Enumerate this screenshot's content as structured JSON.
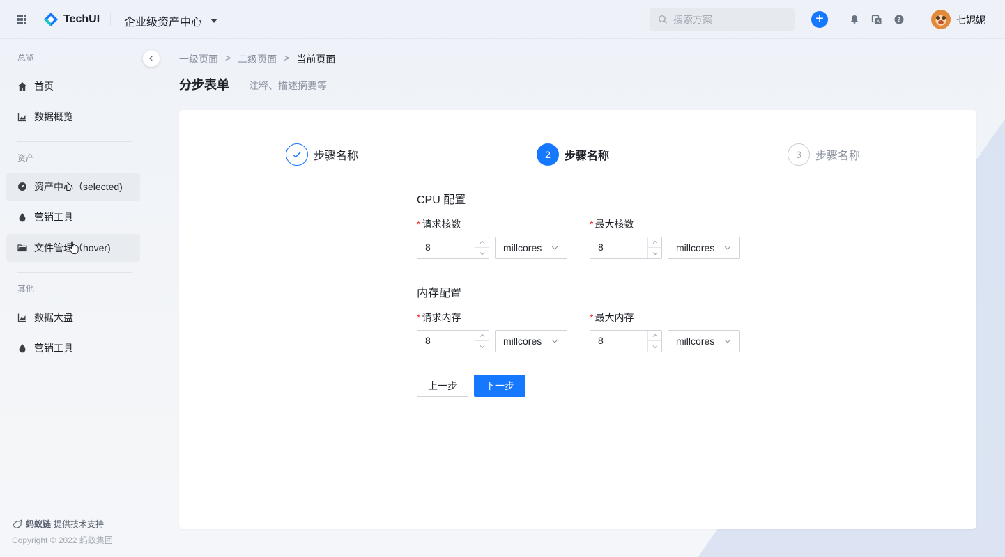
{
  "header": {
    "brand": "TechUI",
    "app_title": "企业级资产中心",
    "search_placeholder": "搜索方案",
    "plus_label": "+",
    "username": "七妮妮"
  },
  "sidebar": {
    "groups": [
      {
        "title": "总览"
      },
      {
        "title": "资产"
      },
      {
        "title": "其他"
      }
    ],
    "items": [
      {
        "label": "首页",
        "icon": "home-icon"
      },
      {
        "label": "数据概览",
        "icon": "chart-icon"
      },
      {
        "label": "资产中心（selected)",
        "icon": "dashboard-icon"
      },
      {
        "label": "营销工具",
        "icon": "drop-icon"
      },
      {
        "label": "文件管理（hover)",
        "icon": "folder-icon"
      },
      {
        "label": "数据大盘",
        "icon": "chart-icon"
      },
      {
        "label": "营销工具",
        "icon": "drop-icon"
      }
    ],
    "footer_brand": "蚂蚁链",
    "footer_support": "提供技术支持",
    "copyright": "Copyright © 2022 蚂蚁集团"
  },
  "breadcrumb": {
    "items": [
      "一级页面",
      "二级页面",
      "当前页面"
    ],
    "separator": ">"
  },
  "page": {
    "title": "分步表单",
    "subtitle": "注释、描述摘要等"
  },
  "steps": [
    {
      "label": "步骤名称",
      "status": "done",
      "index": ""
    },
    {
      "label": "步骤名称",
      "status": "active",
      "index": "2"
    },
    {
      "label": "步骤名称",
      "status": "wait",
      "index": "3"
    }
  ],
  "form": {
    "cpu": {
      "title": "CPU 配置",
      "request_label": "请求核数",
      "request_value": "8",
      "request_unit": "millcores",
      "max_label": "最大核数",
      "max_value": "8",
      "max_unit": "millcores"
    },
    "memory": {
      "title": "内存配置",
      "request_label": "请求内存",
      "request_value": "8",
      "request_unit": "millcores",
      "max_label": "最大内存",
      "max_value": "8",
      "max_unit": "millcores"
    },
    "required_mark": "*",
    "prev_label": "上一步",
    "next_label": "下一步"
  },
  "colors": {
    "primary": "#1677ff",
    "required": "#f5222d"
  }
}
